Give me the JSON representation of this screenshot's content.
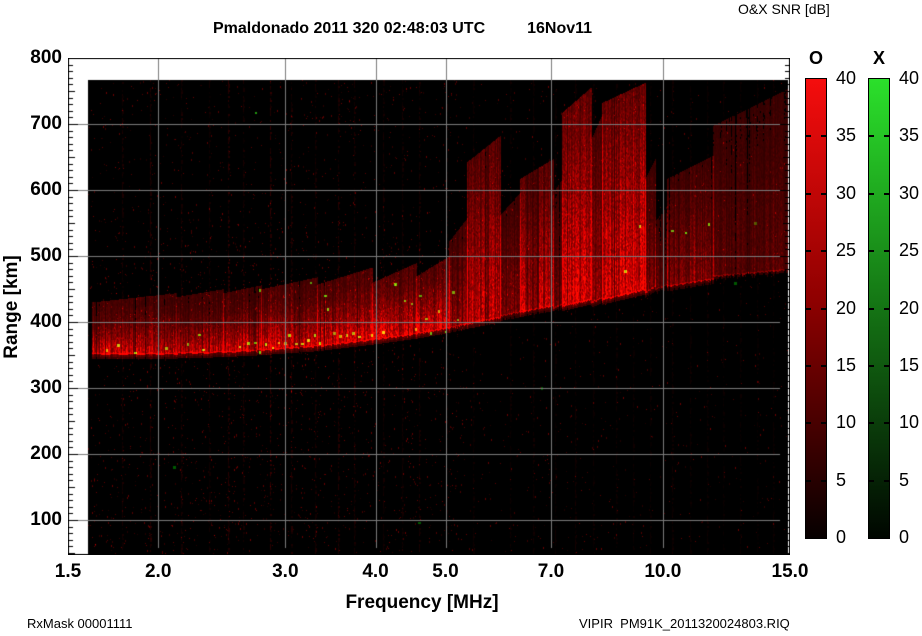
{
  "footer": {
    "rx_mask": "RxMask 00001111",
    "file": "VIPIR  PM91K_2011320024803.RIQ"
  },
  "chart_data": {
    "type": "heatmap",
    "title": "Pmaldonado 2011 320 02:48:03 UTC",
    "date_label": "16Nov11",
    "colorbar_title": "O&X SNR [dB]",
    "xlabel": "Frequency [MHz]",
    "ylabel": "Range [km]",
    "x_scale": "log",
    "x_range": [
      1.5,
      15.0
    ],
    "y_range": [
      47,
      800
    ],
    "x_ticks": [
      {
        "v": 1.5,
        "label": "1.5"
      },
      {
        "v": 2.0,
        "label": "2.0"
      },
      {
        "v": 3.0,
        "label": "3.0"
      },
      {
        "v": 4.0,
        "label": "4.0"
      },
      {
        "v": 5.0,
        "label": "5.0"
      },
      {
        "v": 7.0,
        "label": "7.0"
      },
      {
        "v": 10.0,
        "label": "10.0"
      },
      {
        "v": 15.0,
        "label": "15.0"
      }
    ],
    "y_ticks": [
      {
        "v": 100,
        "label": "100"
      },
      {
        "v": 200,
        "label": "200"
      },
      {
        "v": 300,
        "label": "300"
      },
      {
        "v": 400,
        "label": "400"
      },
      {
        "v": 500,
        "label": "500"
      },
      {
        "v": 600,
        "label": "600"
      },
      {
        "v": 700,
        "label": "700"
      },
      {
        "v": 800,
        "label": "800"
      }
    ],
    "grid": {
      "show": true,
      "color": "#7b7b7b",
      "x_lines": [
        2,
        3,
        4,
        5,
        7,
        10
      ],
      "y_lines": [
        100,
        200,
        300,
        400,
        500,
        600,
        700
      ]
    },
    "data_extent": {
      "f_min": 1.6,
      "f_max": 14.9,
      "r_min": 47,
      "r_max": 766
    },
    "background": "#000000",
    "o_mode_color": "#cc0000",
    "x_mode_color": "#2db52d",
    "noise": {
      "seed": 1320,
      "count": 7000
    },
    "rfi_stripes": [
      {
        "f": 1.78,
        "alpha": 0.1
      },
      {
        "f": 1.95,
        "alpha": 0.14
      },
      {
        "f": 2.15,
        "alpha": 0.1
      },
      {
        "f": 2.35,
        "alpha": 0.08
      },
      {
        "f": 2.5,
        "alpha": 0.16
      },
      {
        "f": 2.62,
        "alpha": 0.1
      },
      {
        "f": 2.86,
        "alpha": 0.18
      },
      {
        "f": 3.05,
        "alpha": 0.12
      },
      {
        "f": 3.3,
        "alpha": 0.1
      },
      {
        "f": 3.55,
        "alpha": 0.14
      },
      {
        "f": 3.74,
        "alpha": 0.1
      },
      {
        "f": 4.1,
        "alpha": 0.08
      },
      {
        "f": 4.35,
        "alpha": 0.08
      },
      {
        "f": 4.6,
        "alpha": 0.1
      },
      {
        "f": 5.0,
        "alpha": 0.08
      },
      {
        "f": 5.45,
        "alpha": 0.06
      },
      {
        "f": 6.15,
        "alpha": 0.06
      },
      {
        "f": 6.6,
        "alpha": 0.07
      },
      {
        "f": 7.1,
        "alpha": 0.06
      },
      {
        "f": 7.55,
        "alpha": 0.08
      },
      {
        "f": 8.0,
        "alpha": 0.06
      },
      {
        "f": 8.6,
        "alpha": 0.07
      },
      {
        "f": 9.1,
        "alpha": 0.06
      },
      {
        "f": 9.6,
        "alpha": 0.05
      },
      {
        "f": 10.3,
        "alpha": 0.07
      },
      {
        "f": 10.9,
        "alpha": 0.06
      },
      {
        "f": 11.5,
        "alpha": 0.06
      },
      {
        "f": 12.1,
        "alpha": 0.05
      },
      {
        "f": 12.8,
        "alpha": 0.05
      },
      {
        "f": 13.5,
        "alpha": 0.05
      },
      {
        "f": 14.2,
        "alpha": 0.05
      }
    ],
    "echo_regions": [
      {
        "f0": 1.62,
        "f1": 2.12,
        "rb0": 352,
        "rb1": 353,
        "rt0": 432,
        "rt1": 446,
        "i": 0.85,
        "exp": 2.4,
        "base": 0.1
      },
      {
        "f0": 2.12,
        "f1": 2.46,
        "rb0": 353,
        "rb1": 355,
        "rt0": 440,
        "rt1": 452,
        "i": 0.7,
        "exp": 2.4,
        "base": 0.1
      },
      {
        "f0": 2.46,
        "f1": 2.78,
        "rb0": 355,
        "rb1": 358,
        "rt0": 446,
        "rt1": 458,
        "i": 0.85,
        "exp": 2.4,
        "base": 0.1
      },
      {
        "f0": 2.78,
        "f1": 3.32,
        "rb0": 358,
        "rb1": 364,
        "rt0": 452,
        "rt1": 470,
        "i": 0.9,
        "exp": 2.2,
        "base": 0.12
      },
      {
        "f0": 3.32,
        "f1": 3.96,
        "rb0": 364,
        "rb1": 374,
        "rt0": 456,
        "rt1": 482,
        "i": 0.92,
        "exp": 2.0,
        "base": 0.14
      },
      {
        "f0": 3.96,
        "f1": 4.56,
        "rb0": 374,
        "rb1": 383,
        "rt0": 462,
        "rt1": 492,
        "i": 0.95,
        "exp": 1.9,
        "base": 0.15
      },
      {
        "f0": 4.56,
        "f1": 5.06,
        "rb0": 383,
        "rb1": 392,
        "rt0": 472,
        "rt1": 502,
        "i": 0.95,
        "exp": 1.9,
        "base": 0.15
      },
      {
        "f0": 5.06,
        "f1": 5.36,
        "rb0": 392,
        "rb1": 398,
        "rt0": 525,
        "rt1": 560,
        "i": 0.6,
        "exp": 1.5,
        "base": 0.18
      },
      {
        "f0": 5.36,
        "f1": 5.96,
        "rb0": 398,
        "rb1": 408,
        "rt0": 645,
        "rt1": 685,
        "i": 0.72,
        "exp": 1.3,
        "base": 0.22
      },
      {
        "f0": 5.96,
        "f1": 6.36,
        "rb0": 410,
        "rb1": 416,
        "rt0": 565,
        "rt1": 600,
        "i": 0.3,
        "exp": 1.3,
        "base": 0.2
      },
      {
        "f0": 6.36,
        "f1": 7.06,
        "rb0": 416,
        "rb1": 425,
        "rt0": 620,
        "rt1": 650,
        "i": 0.65,
        "exp": 1.3,
        "base": 0.22
      },
      {
        "f0": 7.06,
        "f1": 7.26,
        "rb0": 422,
        "rb1": 428,
        "rt0": 600,
        "rt1": 620,
        "i": 0.25,
        "exp": 1.3,
        "base": 0.2
      },
      {
        "f0": 7.26,
        "f1": 7.96,
        "rb0": 425,
        "rb1": 435,
        "rt0": 720,
        "rt1": 758,
        "i": 0.8,
        "exp": 1.2,
        "base": 0.25
      },
      {
        "f0": 7.96,
        "f1": 8.26,
        "rb0": 430,
        "rb1": 438,
        "rt0": 680,
        "rt1": 720,
        "i": 0.45,
        "exp": 1.2,
        "base": 0.22
      },
      {
        "f0": 8.26,
        "f1": 9.46,
        "rb0": 435,
        "rb1": 450,
        "rt0": 735,
        "rt1": 765,
        "i": 0.82,
        "exp": 1.2,
        "base": 0.25
      },
      {
        "f0": 9.46,
        "f1": 9.76,
        "rb0": 445,
        "rb1": 455,
        "rt0": 620,
        "rt1": 650,
        "i": 0.35,
        "exp": 1.3,
        "base": 0.2
      },
      {
        "f0": 9.76,
        "f1": 10.16,
        "rb0": 450,
        "rb1": 458,
        "rt0": 555,
        "rt1": 580,
        "i": 0.16,
        "exp": 1.3,
        "base": 0.2
      },
      {
        "f0": 10.16,
        "f1": 11.76,
        "rb0": 455,
        "rb1": 466,
        "rt0": 620,
        "rt1": 655,
        "i": 0.35,
        "exp": 1.3,
        "base": 0.2
      },
      {
        "f0": 11.76,
        "f1": 14.88,
        "rb0": 470,
        "rb1": 480,
        "rt0": 700,
        "rt1": 755,
        "i": 0.16,
        "exp": 1.2,
        "base": 0.25
      }
    ],
    "x_mode_points": [
      [
        1.7,
        357
      ],
      [
        1.76,
        365
      ],
      [
        1.86,
        353
      ],
      [
        2.05,
        360
      ],
      [
        2.2,
        366
      ],
      [
        2.28,
        381
      ],
      [
        2.31,
        357
      ],
      [
        2.6,
        362
      ],
      [
        2.66,
        368
      ],
      [
        2.73,
        716
      ],
      [
        2.72,
        368
      ],
      [
        2.77,
        355
      ],
      [
        2.77,
        448
      ],
      [
        2.82,
        366
      ],
      [
        2.88,
        360
      ],
      [
        2.94,
        368
      ],
      [
        3.0,
        368
      ],
      [
        3.04,
        381
      ],
      [
        3.1,
        366
      ],
      [
        3.16,
        367
      ],
      [
        3.22,
        372
      ],
      [
        3.26,
        459
      ],
      [
        3.3,
        380
      ],
      [
        3.35,
        368
      ],
      [
        3.4,
        439
      ],
      [
        3.44,
        420
      ],
      [
        3.5,
        383
      ],
      [
        3.57,
        379
      ],
      [
        3.65,
        381
      ],
      [
        3.72,
        383
      ],
      [
        3.8,
        378
      ],
      [
        3.95,
        380
      ],
      [
        4.1,
        385
      ],
      [
        4.25,
        457
      ],
      [
        4.4,
        432
      ],
      [
        4.5,
        427
      ],
      [
        4.55,
        390
      ],
      [
        4.61,
        439
      ],
      [
        4.7,
        404
      ],
      [
        4.78,
        383
      ],
      [
        4.9,
        417
      ],
      [
        5.0,
        385
      ],
      [
        5.12,
        445
      ],
      [
        5.2,
        403
      ],
      [
        8.87,
        477
      ],
      [
        9.3,
        546
      ],
      [
        10.3,
        538
      ],
      [
        10.75,
        535
      ],
      [
        11.6,
        548
      ],
      [
        13.4,
        550,
        1
      ],
      [
        12.6,
        459,
        1
      ],
      [
        6.8,
        300,
        1
      ],
      [
        2.1,
        180,
        1
      ],
      [
        4.6,
        95,
        1
      ]
    ],
    "colorbars": [
      {
        "mode": "O",
        "top_color": "#f50d0d",
        "mid_color": "#8f0000",
        "bottom_color": "#060000",
        "range": [
          0,
          40
        ],
        "ticks": [
          40,
          35,
          30,
          25,
          20,
          15,
          10,
          5,
          0
        ]
      },
      {
        "mode": "X",
        "top_color": "#2be02b",
        "mid_color": "#157815",
        "bottom_color": "#000600",
        "range": [
          0,
          40
        ],
        "ticks": [
          40,
          35,
          30,
          25,
          20,
          15,
          10,
          5,
          0
        ]
      }
    ]
  }
}
